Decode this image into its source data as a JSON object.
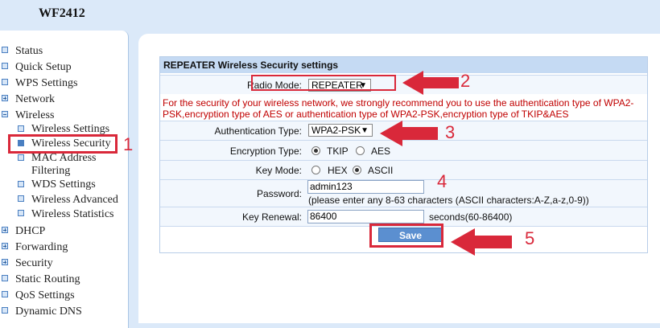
{
  "brand": "WF2412",
  "sidebar": {
    "items": [
      {
        "label": "Status",
        "icon": "page-icon"
      },
      {
        "label": "Quick Setup",
        "icon": "page-icon"
      },
      {
        "label": "WPS Settings",
        "icon": "page-icon"
      },
      {
        "label": "Network",
        "icon": "plus-icon"
      },
      {
        "label": "Wireless",
        "icon": "minus-icon"
      },
      {
        "label": "Wireless Settings",
        "icon": "page-icon"
      },
      {
        "label": "Wireless Security",
        "icon": "arrow-icon"
      },
      {
        "label": "MAC Address",
        "icon": "page-icon"
      },
      {
        "label": "Filtering",
        "icon": ""
      },
      {
        "label": "WDS Settings",
        "icon": "page-icon"
      },
      {
        "label": "Wireless Advanced",
        "icon": "page-icon"
      },
      {
        "label": "Wireless Statistics",
        "icon": "page-icon"
      },
      {
        "label": "DHCP",
        "icon": "plus-icon"
      },
      {
        "label": "Forwarding",
        "icon": "plus-icon"
      },
      {
        "label": "Security",
        "icon": "plus-icon"
      },
      {
        "label": "Static Routing",
        "icon": "page-icon"
      },
      {
        "label": "QoS Settings",
        "icon": "page-icon"
      },
      {
        "label": "Dynamic DNS",
        "icon": "page-icon"
      }
    ]
  },
  "panel": {
    "title": "REPEATER Wireless Security settings",
    "radio_mode_label": "Radio Mode:",
    "radio_mode_value": "REPEATER",
    "warning": "For the security of your wireless network, we strongly recommend you to use the authentication type of WPA2-PSK,encryption type of AES or authentication type of WPA2-PSK,encryption type of TKIP&AES",
    "auth_label": "Authentication Type:",
    "auth_value": "WPA2-PSK",
    "enc_label": "Encryption Type:",
    "enc_options": [
      "TKIP",
      "AES"
    ],
    "enc_selected": "TKIP",
    "keymode_label": "Key Mode:",
    "keymode_options": [
      "HEX",
      "ASCII"
    ],
    "keymode_selected": "ASCII",
    "password_label": "Password:",
    "password_value": "admin123",
    "password_hint": "(please enter any 8-63 characters (ASCII characters:A-Z,a-z,0-9))",
    "renewal_label": "Key Renewal:",
    "renewal_value": "86400",
    "renewal_unit": "seconds(60-86400)",
    "save_label": "Save"
  },
  "annotations": {
    "n1": "1",
    "n2": "2",
    "n3": "3",
    "n4": "4",
    "n5": "5",
    "color": "#d9283a"
  }
}
